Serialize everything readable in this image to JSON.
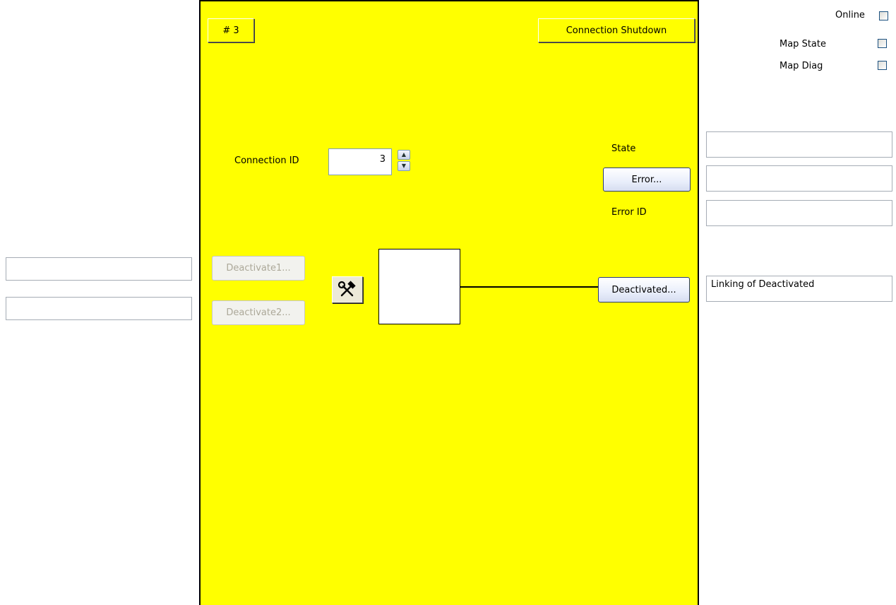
{
  "header": {
    "index_label": "# 3",
    "shutdown_label": "Connection Shutdown"
  },
  "options": [
    {
      "label": "Online",
      "checked": false
    },
    {
      "label": "Map State",
      "checked": false
    },
    {
      "label": "Map Diag",
      "checked": false
    }
  ],
  "connection": {
    "label": "Connection ID",
    "value": "3"
  },
  "status": {
    "state_label": "State",
    "error_button": "Error...",
    "error_id_label": "Error ID"
  },
  "left_buttons": {
    "deactivate1": "Deactivate1...",
    "deactivate2": "Deactivate2..."
  },
  "tool_icon": "hammer-wrench-icon",
  "deactivated_button": "Deactivated...",
  "right_fields": [
    "",
    "",
    "",
    "Linking of Deactivated"
  ],
  "left_fields": [
    "",
    ""
  ],
  "colors": {
    "panel": "#ffff00",
    "panel_border": "#000000"
  }
}
